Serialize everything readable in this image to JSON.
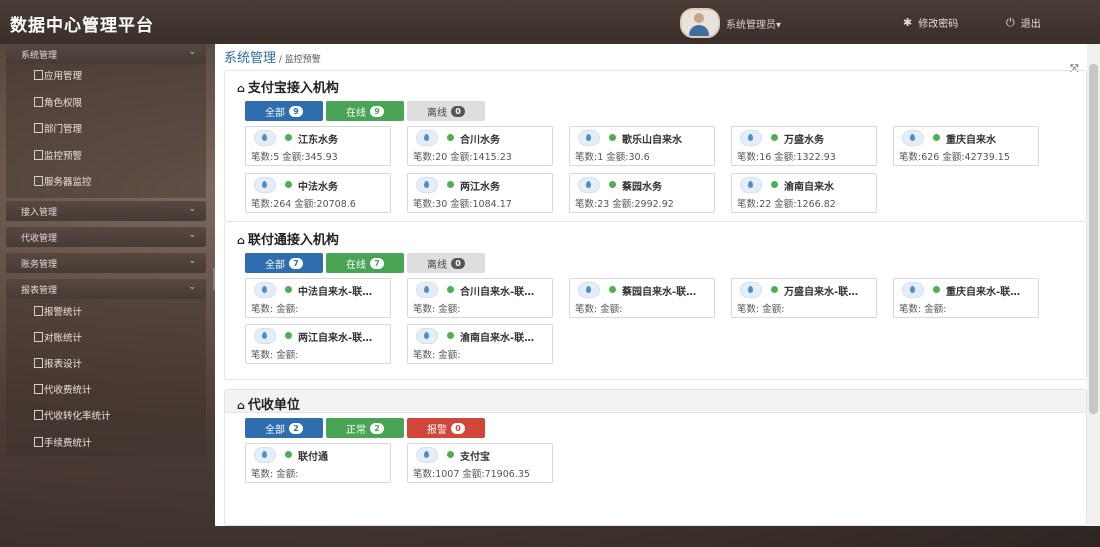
{
  "header": {
    "title": "数据中心管理平台",
    "user_name": "系统管理员▾",
    "change_password": "修改密码",
    "logout": "退出"
  },
  "sidebar": {
    "groups": [
      {
        "label": "系统管理",
        "items": [
          "应用管理",
          "角色权限",
          "部门管理",
          "监控预警",
          "服务器监控"
        ]
      },
      {
        "label": "接入管理",
        "items": []
      },
      {
        "label": "代收管理",
        "items": []
      },
      {
        "label": "账务管理",
        "items": []
      },
      {
        "label": "报表管理",
        "items": [
          "报警统计",
          "对账统计",
          "报表设计",
          "代收费统计",
          "代收转化率统计",
          "手续费统计"
        ]
      }
    ]
  },
  "breadcrumb": {
    "parent": "系统管理",
    "sep": " / ",
    "current": "监控预警"
  },
  "sections": [
    {
      "title": "支付宝接入机构",
      "tabs": [
        {
          "label": "全部",
          "count": "9"
        },
        {
          "label": "在线",
          "count": "9"
        },
        {
          "label": "离线",
          "count": "0"
        }
      ],
      "cards": [
        {
          "name": "江东水务",
          "stats": "笔数:5  金额:345.93"
        },
        {
          "name": "合川水务",
          "stats": "笔数:20  金额:1415.23"
        },
        {
          "name": "歌乐山自来水",
          "stats": "笔数:1  金额:30.6"
        },
        {
          "name": "万盛水务",
          "stats": "笔数:16  金额:1322.93"
        },
        {
          "name": "重庆自来水",
          "stats": "笔数:626  金额:42739.15"
        },
        {
          "name": "中法水务",
          "stats": "笔数:264  金额:20708.6"
        },
        {
          "name": "两江水务",
          "stats": "笔数:30  金额:1084.17"
        },
        {
          "name": "蔡园水务",
          "stats": "笔数:23  金额:2992.92"
        },
        {
          "name": "渝南自来水",
          "stats": "笔数:22  金额:1266.82"
        }
      ]
    },
    {
      "title": "联付通接入机构",
      "tabs": [
        {
          "label": "全部",
          "count": "7"
        },
        {
          "label": "在线",
          "count": "7"
        },
        {
          "label": "离线",
          "count": "0"
        }
      ],
      "cards": [
        {
          "name": "中法自来水-联…",
          "stats": "笔数:  金额:"
        },
        {
          "name": "合川自来水-联…",
          "stats": "笔数:  金额:"
        },
        {
          "name": "蔡园自来水-联…",
          "stats": "笔数:  金额:"
        },
        {
          "name": "万盛自来水-联…",
          "stats": "笔数:  金额:"
        },
        {
          "name": "重庆自来水-联…",
          "stats": "笔数:  金额:"
        },
        {
          "name": "两江自来水-联…",
          "stats": "笔数:  金额:"
        },
        {
          "name": "渝南自来水-联…",
          "stats": "笔数:  金额:"
        }
      ]
    },
    {
      "title": "代收单位",
      "tabs": [
        {
          "label": "全部",
          "count": "2"
        },
        {
          "label": "正常",
          "count": "2"
        },
        {
          "label": "报警",
          "count": "0"
        }
      ],
      "cards": [
        {
          "name": "联付通",
          "stats": "笔数:  金额:"
        },
        {
          "name": "支付宝",
          "stats": "笔数:1007  金额:71906.35"
        }
      ]
    }
  ],
  "icons": {
    "home": "home-icon",
    "gear": "gear-icon",
    "power": "power-icon",
    "expand": "expand-icon",
    "water_drop": "water-drop-icon"
  },
  "colors": {
    "primary": "#2f6eae",
    "success": "#4aa456",
    "danger": "#d1453b",
    "online_dot": "#4caf50"
  }
}
